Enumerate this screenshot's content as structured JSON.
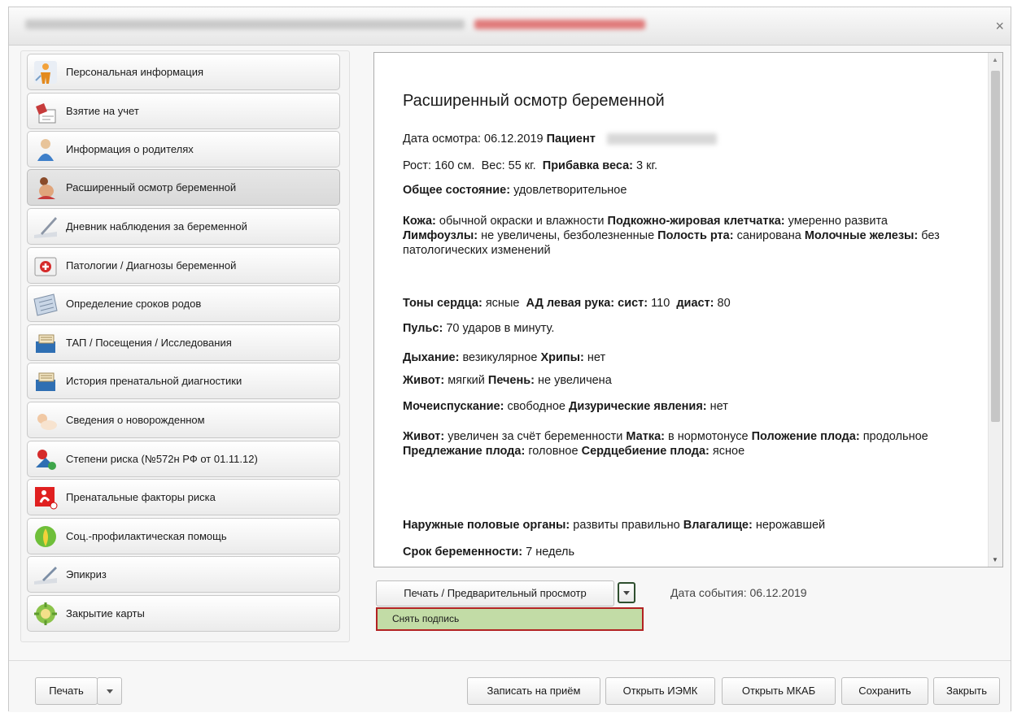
{
  "nav": {
    "items": [
      {
        "label": "Персональная информация",
        "icon": "person-icon"
      },
      {
        "label": "Взятие на учет",
        "icon": "registration-icon"
      },
      {
        "label": "Информация о родителях",
        "icon": "parents-icon"
      },
      {
        "label": "Расширенный осмотр беременной",
        "icon": "pregnant-exam-icon"
      },
      {
        "label": "Дневник наблюдения за беременной",
        "icon": "diary-pen-icon"
      },
      {
        "label": "Патологии / Диагнозы беременной",
        "icon": "first-aid-kit-icon"
      },
      {
        "label": "Определение сроков родов",
        "icon": "calendar-icon"
      },
      {
        "label": "ТАП / Посещения / Исследования",
        "icon": "card-file-icon"
      },
      {
        "label": "История пренатальной диагностики",
        "icon": "card-file-icon"
      },
      {
        "label": "Сведения о новорожденном",
        "icon": "newborn-icon"
      },
      {
        "label": "Степени риска (№572н РФ от 01.11.12)",
        "icon": "risk-degrees-icon"
      },
      {
        "label": "Пренатальные факторы риска",
        "icon": "risk-factors-icon"
      },
      {
        "label": "Соц.-профилактическая помощь",
        "icon": "social-help-icon"
      },
      {
        "label": "Эпикриз",
        "icon": "epicrisis-pen-icon"
      },
      {
        "label": "Закрытие карты",
        "icon": "close-card-icon"
      }
    ],
    "active_index": 3
  },
  "document": {
    "title": "Расширенный осмотр беременной",
    "exam_date_label": "Дата осмотра:",
    "exam_date": "06.12.2019",
    "patient_label": "Пациент",
    "height_label": "Рост:",
    "height_value": "160 см.",
    "weight_label": "Вес:",
    "weight_value": "55 кг.",
    "weight_gain_label": "Прибавка веса:",
    "weight_gain_value": "3 кг.",
    "general_label": "Общее состояние:",
    "general_value": "удовлетворительное",
    "skin_label": "Кожа:",
    "skin_value": "обычной окраски и влажности",
    "fat_label": "Подкожно-жировая клетчатка:",
    "fat_value": "умеренно развита",
    "lymph_label": "Лимфоузлы:",
    "lymph_value": "не увеличены, безболезненные",
    "mouth_label": "Полость рта:",
    "mouth_value": "санирована",
    "breast_label": "Молочные железы:",
    "breast_value": "без патологических изменений",
    "heart_label": "Тоны сердца:",
    "heart_value": "ясные",
    "bp_label": "АД левая рука: сист:",
    "bp_sys": "110",
    "bp_dia_label": "диаст:",
    "bp_dia": "80",
    "pulse_label": "Пульс:",
    "pulse_value": "70 ударов в минуту.",
    "breath_label": "Дыхание:",
    "breath_value": "везикулярное",
    "rales_label": "Хрипы:",
    "rales_value": "нет",
    "abdomen_label": "Живот:",
    "abdomen_value": "мягкий",
    "liver_label": "Печень:",
    "liver_value": "не увеличена",
    "urination_label": "Мочеиспускание:",
    "urination_value": "свободное",
    "dysuria_label": "Дизурические явления:",
    "dysuria_value": "нет",
    "abdomen2_label": "Живот:",
    "abdomen2_value": "увеличен за счёт беременности",
    "uterus_label": "Матка:",
    "uterus_value": "в нормотонусе",
    "position_label": "Положение плода:",
    "position_value": "продольное",
    "presentation_label": "Предлежание плода:",
    "presentation_value": "головное",
    "heartbeat_label": "Сердцебиение плода:",
    "heartbeat_value": "ясное",
    "genitals_label": "Наружные половые органы:",
    "genitals_value": "развиты правильно",
    "vagina_label": "Влагалище:",
    "vagina_value": "нерожавшей",
    "term_label": "Срок беременности:",
    "term_value": "7 недель"
  },
  "actions": {
    "print_preview_label": "Печать / Предварительный просмотр",
    "event_date_label": "Дата события: 06.12.2019",
    "dropdown_item_label": "Снять подпись"
  },
  "footer": {
    "print_label": "Печать",
    "appointment_label": "Записать на приём",
    "open_iemk_label": "Открыть ИЭМК",
    "open_mkab_label": "Открыть МКАБ",
    "save_label": "Сохранить",
    "close_label": "Закрыть"
  },
  "colors": {
    "dropdown_highlight": "#c2dca6",
    "dropdown_border": "#b22222",
    "title_redacted": "#e07a7a"
  }
}
